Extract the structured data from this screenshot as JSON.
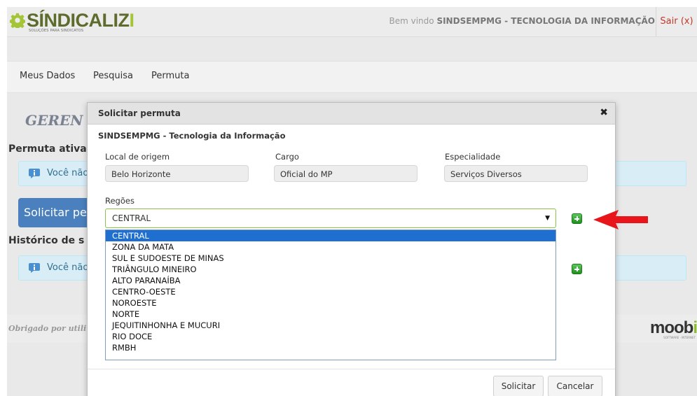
{
  "header": {
    "logo_text_a": "SÍNDICALIZ",
    "logo_text_b": "I",
    "logo_tagline": "SOLUÇÕES PARA SINDICATOS",
    "welcome_prefix": "Bem vindo",
    "welcome_user": "SINDSEMPMG - TECNOLOGIA DA INFORMAÇÃO",
    "logout_label": "Sair (x)"
  },
  "nav": {
    "items": [
      {
        "label": "Meus Dados"
      },
      {
        "label": "Pesquisa"
      },
      {
        "label": "Permuta"
      }
    ]
  },
  "background": {
    "page_title": "GEREN",
    "section_active": "Permuta ativa",
    "alert_active": "Você não",
    "request_button": "Solicitar per",
    "section_history": "Histórico de s",
    "alert_history": "Você não",
    "footer_text": "Obrigado por utili",
    "footer_logo_a": "moob",
    "footer_logo_b": "i",
    "footer_logo_tagline": "SOFTWARE · INTERNET"
  },
  "modal": {
    "title": "Solicitar permuta",
    "close_symbol": "✖",
    "org_name": "SINDSEMPMG - Tecnologia da Informação",
    "fields": [
      {
        "label": "Local de origem",
        "value": "Belo Horizonte"
      },
      {
        "label": "Cargo",
        "value": "Oficial do MP"
      },
      {
        "label": "Especialidade",
        "value": "Serviços Diversos"
      }
    ],
    "regions_label": "Regões",
    "selected_region": "CENTRAL",
    "region_options": [
      "CENTRAL",
      "ZONA DA MATA",
      "SUL E SUDOESTE DE MINAS",
      "TRIÂNGULO MINEIRO",
      "ALTO PARANAÍBA",
      "CENTRO-OESTE",
      "NOROESTE",
      "NORTE",
      "JEQUITINHONHA E MUCURI",
      "RIO DOCE",
      "RMBH"
    ],
    "submit_label": "Solicitar",
    "cancel_label": "Cancelar"
  },
  "colors": {
    "logo_green": "#a3c536",
    "logout_red": "#c0392b",
    "alert_bg": "#d9edf7",
    "primary_button": "#4a80bd",
    "selected_option": "#1e6fd0",
    "annotation_arrow": "#e8161b"
  },
  "icons": {
    "logo": "gear-icon",
    "alert": "info-icon",
    "add": "plus-icon",
    "annotation": "arrow-left-icon"
  }
}
